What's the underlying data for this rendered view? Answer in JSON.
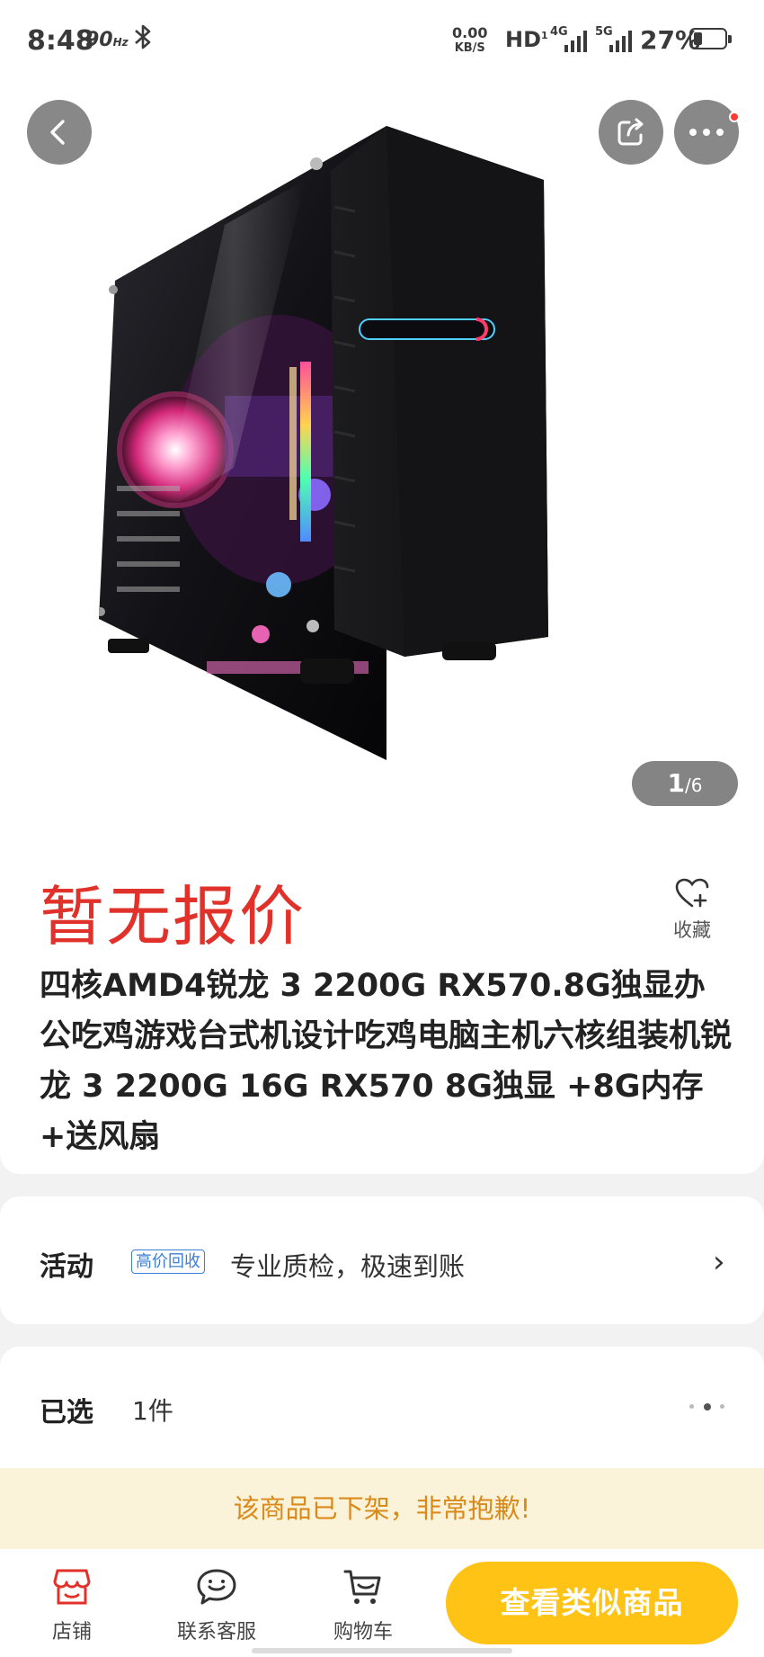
{
  "status_bar": {
    "time": "8:48",
    "refresh_rate": "90",
    "refresh_unit": "Hz",
    "net_speed_value": "0.00",
    "net_speed_unit": "KB/S",
    "hd": "HD",
    "sim1": "4G",
    "sim2": "5G",
    "battery_percent": "27%",
    "battery_level": 0.27
  },
  "gallery": {
    "current": "1",
    "total": "/6"
  },
  "price_label": "暂无报价",
  "favorite_label": "收藏",
  "title": "四核AMD4锐龙 3 2200G RX570.8G独显办公吃鸡游戏台式机设计吃鸡电脑主机六核组装机锐龙 3 2200G 16G RX570 8G独显 +8G内存+送风扇",
  "activity": {
    "label": "活动",
    "tag": "高价回收",
    "text": "专业质检，极速到账"
  },
  "selected": {
    "label": "已选",
    "value": "1件"
  },
  "notice": "该商品已下架，非常抱歉!",
  "tabbar": {
    "shop": "店铺",
    "service": "联系客服",
    "cart": "购物车",
    "similar_button": "查看类似商品"
  },
  "colors": {
    "price": "#e0322a",
    "accent_button": "#ffc316",
    "notice_bg": "#fbf3d9",
    "notice_text": "#d98a1a",
    "tag_blue": "#3b7fd6"
  }
}
